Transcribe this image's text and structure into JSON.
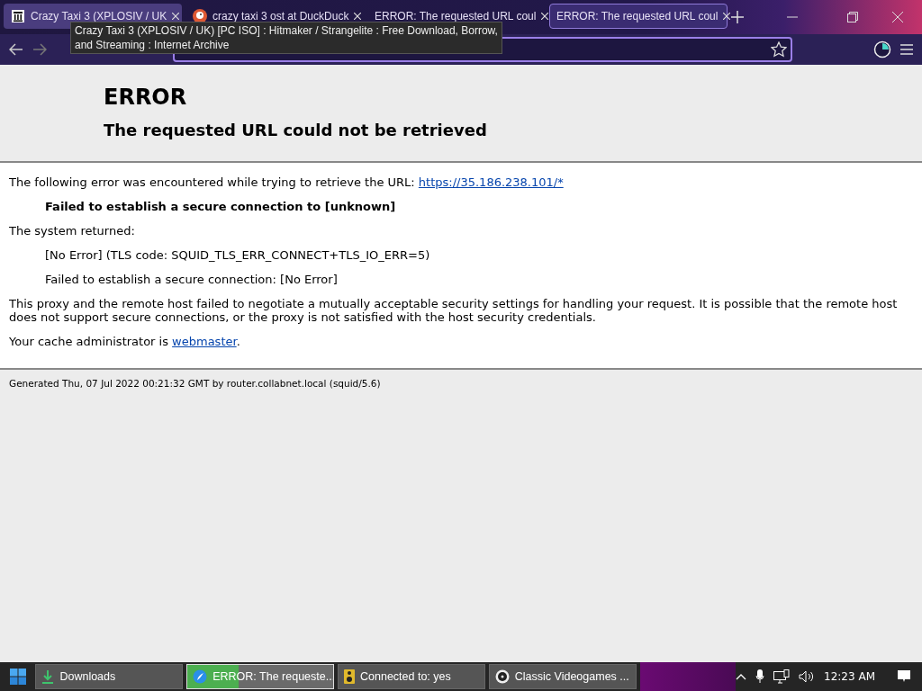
{
  "tabs": [
    {
      "title": "Crazy Taxi 3 (XPLOSIV / UK",
      "kind": "archive",
      "selected": false,
      "hovered": true
    },
    {
      "title": "crazy taxi 3 ost at DuckDuck",
      "kind": "duck",
      "selected": false,
      "hovered": false
    },
    {
      "title": "ERROR: The requested URL coul",
      "kind": "plain",
      "selected": false,
      "hovered": false
    },
    {
      "title": "ERROR: The requested URL coul",
      "kind": "plain",
      "selected": true,
      "hovered": false
    }
  ],
  "tooltip": "Crazy Taxi 3 (XPLOSIV / UK) [PC ISO] : Hitmaker / Strangelite : Free Download, Borrow, and Streaming : Internet Archive",
  "page": {
    "title": "ERROR",
    "subtitle": "The requested URL could not be retrieved",
    "intro": "The following error was encountered while trying to retrieve the URL: ",
    "intro_link": "https://35.186.238.101/*",
    "error": "Failed to establish a secure connection to [unknown]",
    "returned": "The system returned:",
    "details": [
      "[No Error] (TLS code: SQUID_TLS_ERR_CONNECT+TLS_IO_ERR=5)",
      "Failed to establish a secure connection: [No Error]"
    ],
    "explanation": "This proxy and the remote host failed to negotiate a mutually acceptable security settings for handling your request. It is possible that the remote host does not support secure connections, or the proxy is not satisfied with the host security credentials.",
    "admin": "Your cache administrator is ",
    "admin_link": "webmaster",
    "admin_end": ".",
    "footer": "Generated Thu, 07 Jul 2022 00:21:32 GMT by router.collabnet.local (squid/5.6)"
  },
  "taskbar": {
    "items": [
      {
        "label": "Downloads",
        "kind": "download",
        "selected": false
      },
      {
        "label": "ERROR: The requeste...",
        "kind": "browser",
        "selected": true,
        "level": 0.35
      },
      {
        "label": "Connected to: yes",
        "kind": "speaker",
        "selected": false
      },
      {
        "label": "Classic Videogames ...",
        "kind": "disc",
        "selected": false
      }
    ],
    "clock": "12:23 AM"
  }
}
